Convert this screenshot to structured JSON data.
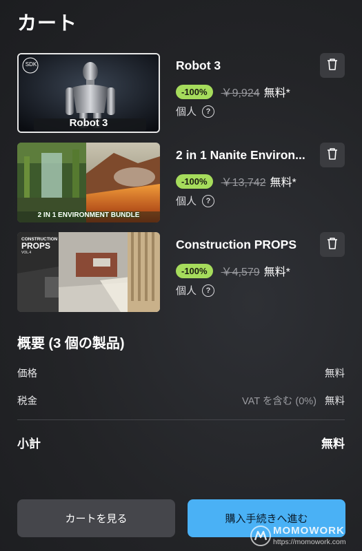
{
  "header": {
    "title": "カート"
  },
  "items": [
    {
      "name": "Robot 3",
      "thumb_text": "Robot 3",
      "thumb_logo": "SDK",
      "discount": "-100%",
      "original_price": "￥9,924",
      "price": "無料*",
      "license": "個人",
      "help_icon": "?"
    },
    {
      "name": "2 in 1 Nanite Environ...",
      "thumb_text": "2 IN 1 ENVIRONMENT BUNDLE",
      "discount": "-100%",
      "original_price": "￥13,742",
      "price": "無料*",
      "license": "個人",
      "help_icon": "?"
    },
    {
      "name": "Construction PROPS",
      "thumb_title_1": "CONSTRUCTION",
      "thumb_title_2": "PROPS",
      "thumb_vol": "VOL.4",
      "discount": "-100%",
      "original_price": "￥4,579",
      "price": "無料*",
      "license": "個人",
      "help_icon": "?"
    }
  ],
  "summary": {
    "title": "概要 (3 個の製品)",
    "price_label": "価格",
    "price_value": "無料",
    "tax_label": "税金",
    "tax_note": "VAT を含む (0%)",
    "tax_value": "無料",
    "subtotal_label": "小計",
    "subtotal_value": "無料"
  },
  "buttons": {
    "view_cart": "カートを見る",
    "checkout": "購入手続きへ進む"
  },
  "watermark": {
    "brand": "MOMOWORK",
    "url": "https://momowork.com"
  },
  "colors": {
    "badge": "#a6dc5c",
    "checkout": "#4ab1f5",
    "background": "#232427"
  },
  "icons": [
    "trash-icon",
    "help-icon"
  ]
}
